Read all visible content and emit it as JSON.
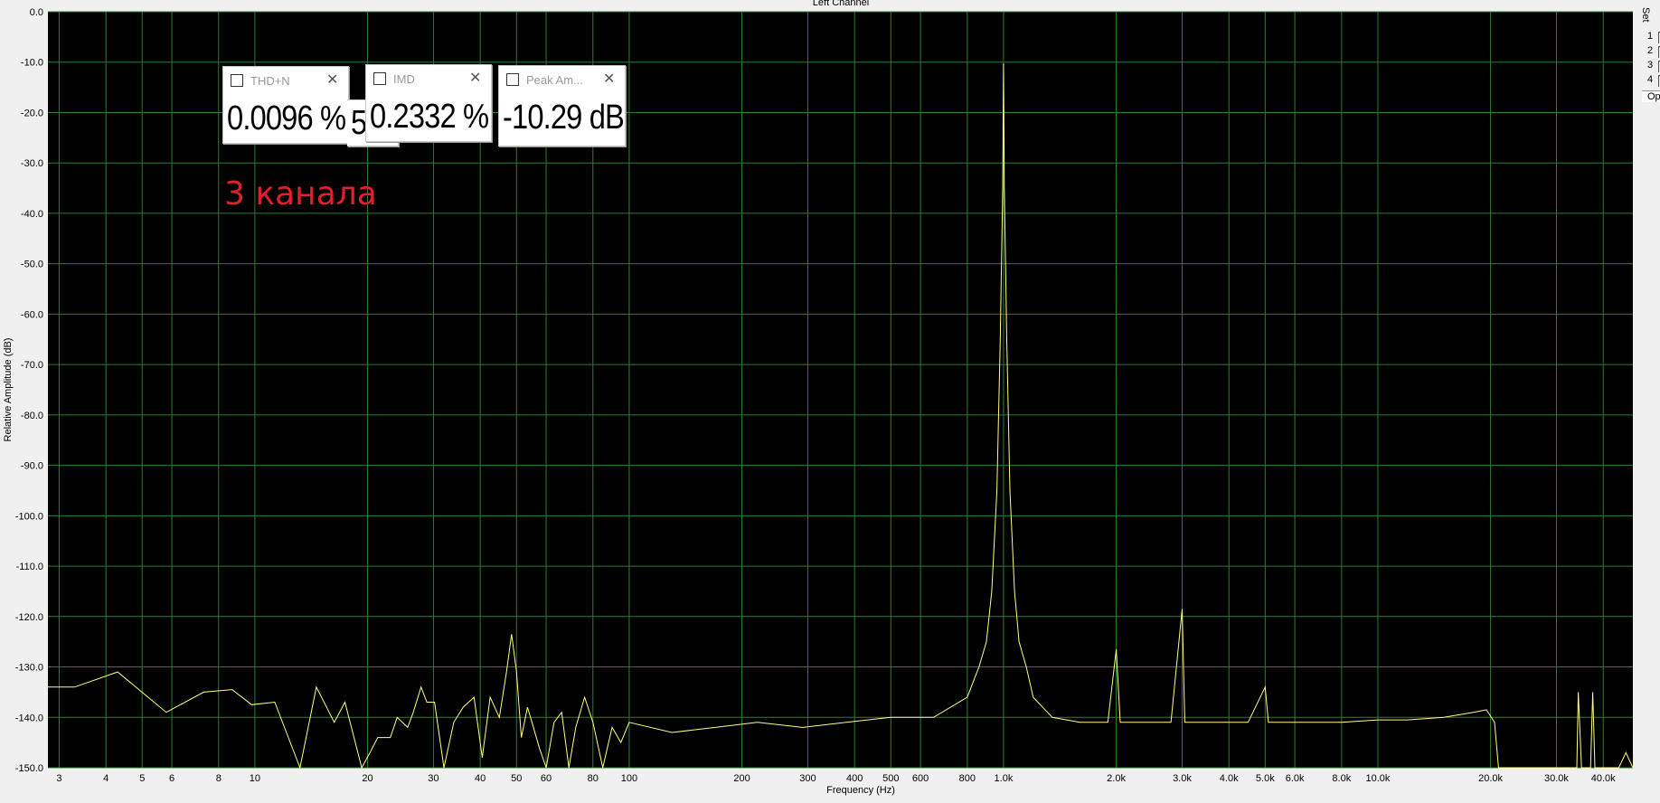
{
  "chart_data": {
    "type": "line",
    "title": "Left Channel",
    "xlabel": "Frequency (Hz)",
    "ylabel": "Relative Amplitude (dB)",
    "x_scale": "log",
    "xlim": [
      2.8,
      48000
    ],
    "ylim": [
      -150,
      0
    ],
    "grid": true,
    "y_ticks": [
      0,
      -10,
      -20,
      -30,
      -40,
      -50,
      -60,
      -70,
      -80,
      -90,
      -100,
      -110,
      -120,
      -130,
      -140,
      -150
    ],
    "y_tick_labels": [
      "0.0",
      "-10.0",
      "-20.0",
      "-30.0",
      "-40.0",
      "-50.0",
      "-60.0",
      "-70.0",
      "-80.0",
      "-90.0",
      "-100.0",
      "-110.0",
      "-120.0",
      "-130.0",
      "-140.0",
      "-150.0"
    ],
    "x_ticks": [
      3,
      4,
      5,
      6,
      8,
      10,
      20,
      30,
      40,
      50,
      60,
      80,
      100,
      200,
      300,
      400,
      500,
      600,
      800,
      1000,
      2000,
      3000,
      4000,
      5000,
      6000,
      8000,
      10000,
      20000,
      30000,
      40000
    ],
    "x_tick_labels": [
      "3",
      "4",
      "5",
      "6",
      "8",
      "10",
      "20",
      "30",
      "40",
      "50",
      "60",
      "80",
      "100",
      "200",
      "300",
      "400",
      "500",
      "600",
      "800",
      "1.0k",
      "2.0k",
      "3.0k",
      "4.0k",
      "5.0k",
      "6.0k",
      "8.0k",
      "10.0k",
      "20.0k",
      "30.0k",
      "40.0k"
    ],
    "series": [
      {
        "color": "#ffff80",
        "x": [
          2.8,
          3.3,
          4.3,
          5.8,
          7.3,
          8.7,
          9.8,
          11.3,
          13.2,
          14.6,
          16.3,
          17.4,
          19.3,
          20.3,
          21.3,
          23.0,
          24.0,
          25.6,
          26.5,
          27.8,
          28.8,
          30.2,
          32.0,
          34.0,
          36.0,
          38.5,
          40.5,
          42.5,
          45.0,
          47.0,
          48.5,
          50.0,
          51.5,
          53.5,
          55.0,
          57.5,
          60.0,
          63.0,
          66.0,
          69.0,
          72.0,
          76.0,
          80.0,
          85.0,
          90.0,
          95.0,
          100,
          130,
          170,
          220,
          290,
          380,
          500,
          650,
          800,
          860,
          900,
          930,
          960,
          980,
          995,
          1000,
          1005,
          1020,
          1040,
          1070,
          1100,
          1150,
          1200,
          1350,
          1600,
          1900,
          2000,
          2050,
          2300,
          2800,
          3000,
          3050,
          3500,
          4500,
          5000,
          5100,
          6000,
          8000,
          10000,
          12000,
          15000,
          18000,
          19500,
          20500,
          21000,
          24000,
          30000,
          34000,
          34300,
          35000,
          37000,
          37500,
          38000,
          44000,
          46000,
          48000
        ],
        "y": [
          -134,
          -134,
          -131,
          -139,
          -135,
          -134.5,
          -137.5,
          -137,
          -150,
          -134,
          -141,
          -137,
          -150,
          -147,
          -144,
          -144,
          -140,
          -142,
          -139,
          -134,
          -137,
          -137,
          -150,
          -141,
          -138,
          -136,
          -148,
          -136,
          -140,
          -131,
          -123.5,
          -131,
          -144,
          -138,
          -141,
          -146,
          -150,
          -141,
          -139,
          -150,
          -142,
          -136,
          -141,
          -150,
          -142,
          -145,
          -141,
          -143,
          -142,
          -141,
          -142,
          -141,
          -140,
          -140,
          -136,
          -130,
          -125,
          -115,
          -95,
          -65,
          -35,
          -10.3,
          -35,
          -65,
          -95,
          -115,
          -125,
          -130,
          -136,
          -140,
          -141,
          -141,
          -126.5,
          -141,
          -141,
          -141,
          -118.5,
          -141,
          -141,
          -141,
          -134,
          -141,
          -141,
          -141,
          -140.5,
          -140.5,
          -140,
          -139,
          -138.5,
          -141,
          -150,
          -150,
          -150,
          -150,
          -135,
          -150,
          -150,
          -135,
          -150,
          -150,
          -147,
          -150
        ]
      }
    ]
  },
  "widgets": {
    "thdn": {
      "title": "THD+N",
      "value": "0.0096 %"
    },
    "hidden": {
      "value": "5"
    },
    "imd": {
      "title": "IMD",
      "value": "0.2332 %"
    },
    "peak": {
      "title": "Peak Am...",
      "value": "-10.29 dB"
    }
  },
  "annotation": "3 канала",
  "side_panel": {
    "header": "Set",
    "rows": [
      "1",
      "2",
      "3",
      "4"
    ],
    "option_label": "Opt"
  },
  "icons": {
    "widget_icon": "meter-icon",
    "widget_close": "close-icon"
  },
  "colors": {
    "plot_bg": "#000000",
    "grid": "#2e7d32",
    "trace": "#ffff80",
    "annotation": "#e0202a"
  }
}
